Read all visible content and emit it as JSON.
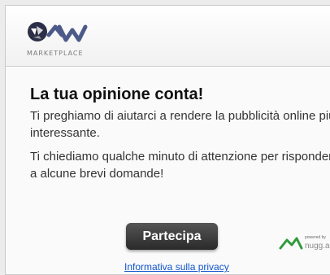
{
  "header": {
    "logo_text": "MARKETPLACE",
    "logo_icon": "4w-logo-icon",
    "colors": {
      "logo_dark": "#2b2f48",
      "logo_light": "#4c5a8a",
      "accent": "#2f9a3a"
    }
  },
  "main": {
    "title": "La tua opinione conta!",
    "para1": "Ti preghiamo di aiutarci a rendere la pubblicità online più interessante.",
    "para2": "Ti chiediamo qualche minuto di attenzione per rispondere a alcune brevi domande!"
  },
  "cta": {
    "label": "Partecipa"
  },
  "footer": {
    "privacy_link": "Informativa sulla privacy",
    "powered_small": "powered by",
    "powered_brand": "nugg.ad"
  }
}
